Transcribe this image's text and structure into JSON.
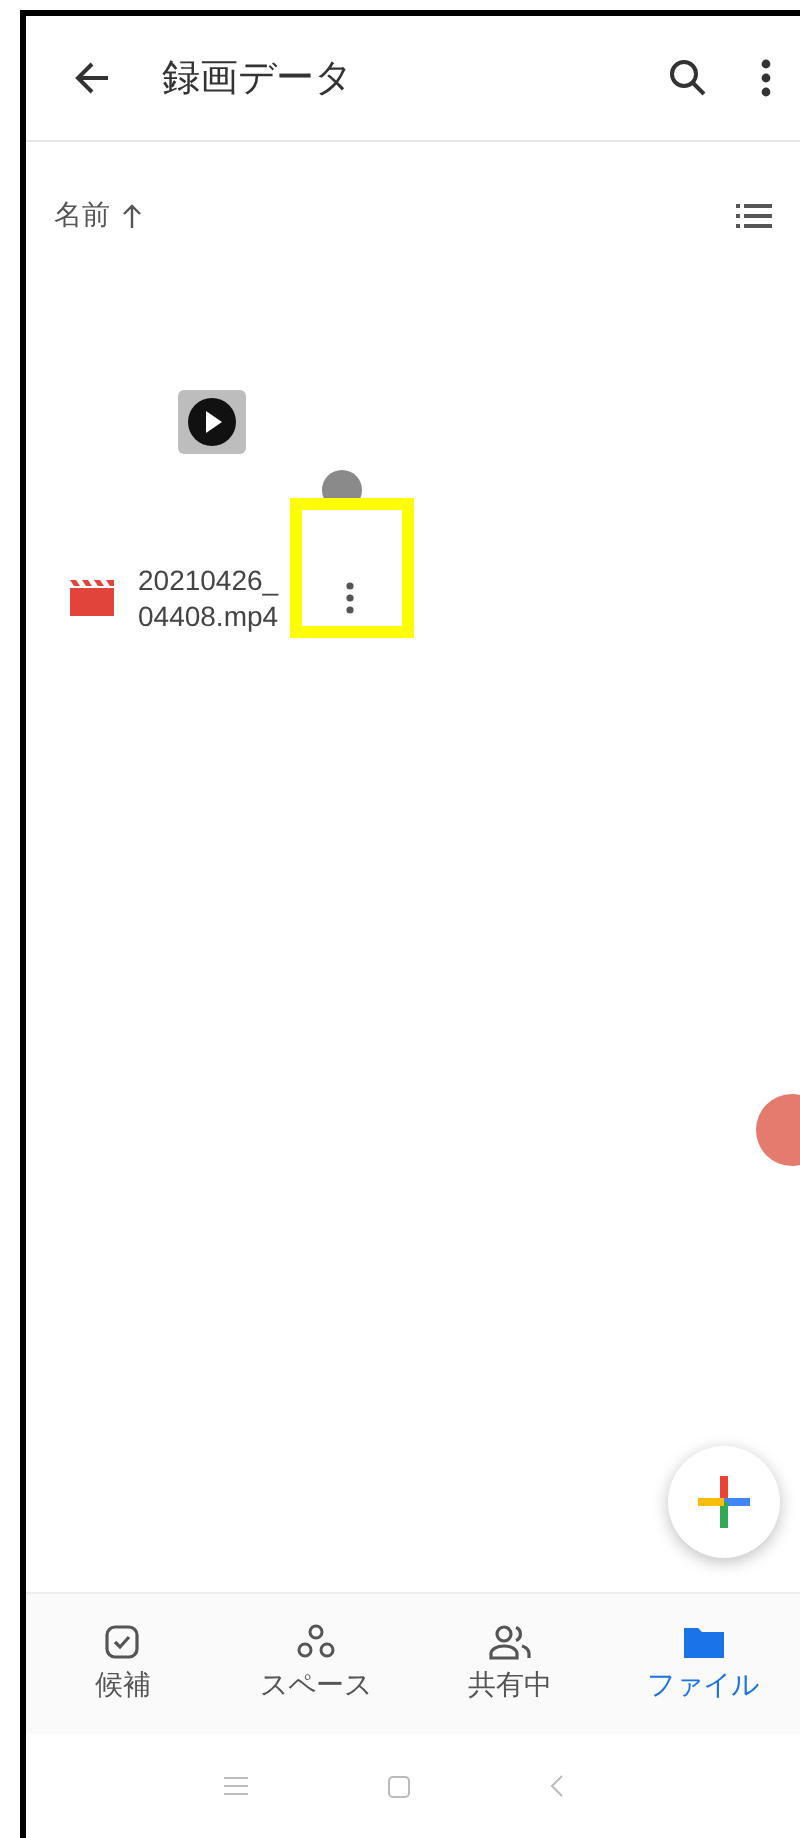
{
  "header": {
    "title": "録画データ"
  },
  "sort": {
    "label": "名前"
  },
  "files": [
    {
      "kind": "video",
      "name_lines": [
        "20210426_",
        "04408.mp4"
      ]
    }
  ],
  "bottom_nav": [
    {
      "kind": "suggested",
      "label": "候補",
      "selected": false
    },
    {
      "kind": "spaces",
      "label": "スペース",
      "selected": false
    },
    {
      "kind": "shared",
      "label": "共有中",
      "selected": false
    },
    {
      "kind": "files",
      "label": "ファイル",
      "selected": true
    }
  ]
}
